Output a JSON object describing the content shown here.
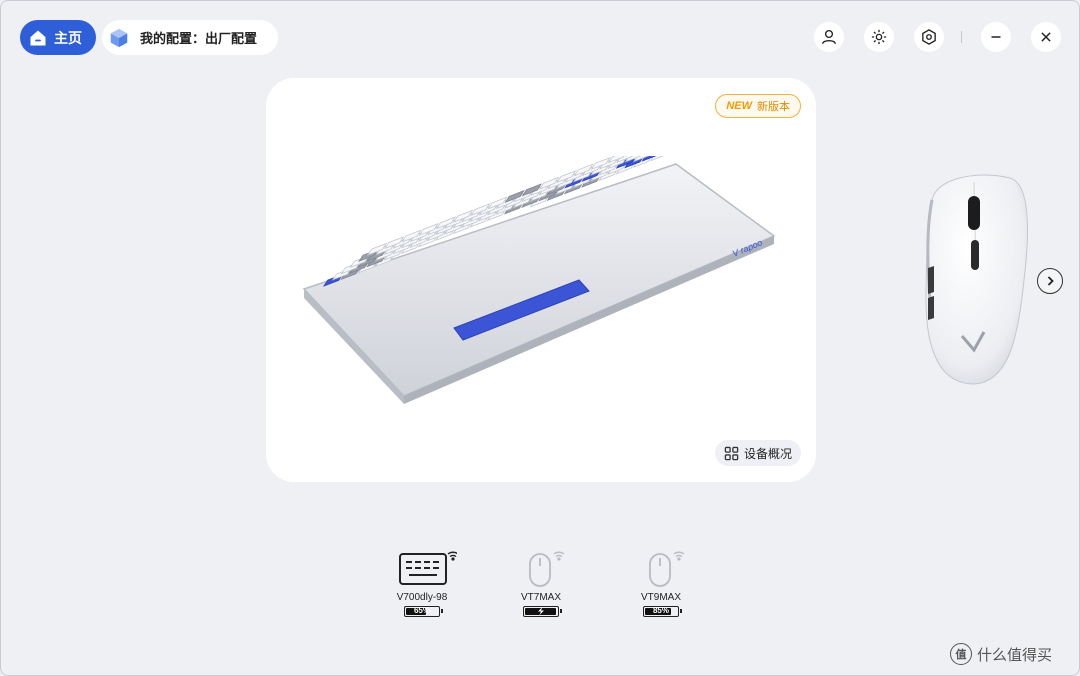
{
  "header": {
    "home_label": "主页",
    "config_label": "我的配置：出厂配置",
    "icons": [
      "user-icon",
      "brightness-icon",
      "settings-icon",
      "minimize-icon",
      "close-icon"
    ]
  },
  "main_card": {
    "badge_new": "NEW",
    "badge_text": "新版本",
    "overview_label": "设备概况",
    "keyboard_brand": "V rapoo"
  },
  "devices": [
    {
      "name": "V700dly-98",
      "battery_text": "65%",
      "battery_level": 0.65,
      "type": "keyboard"
    },
    {
      "name": "VT7MAX",
      "battery_text": "",
      "battery_level": 1.0,
      "charging": true,
      "type": "mouse"
    },
    {
      "name": "VT9MAX",
      "battery_text": "85%",
      "battery_level": 0.85,
      "type": "mouse"
    }
  ],
  "watermark": {
    "logo": "值",
    "text": "什么值得买"
  },
  "colors": {
    "accent": "#2f5fd8",
    "badge": "#f29a00",
    "background": "#eef0f4"
  }
}
